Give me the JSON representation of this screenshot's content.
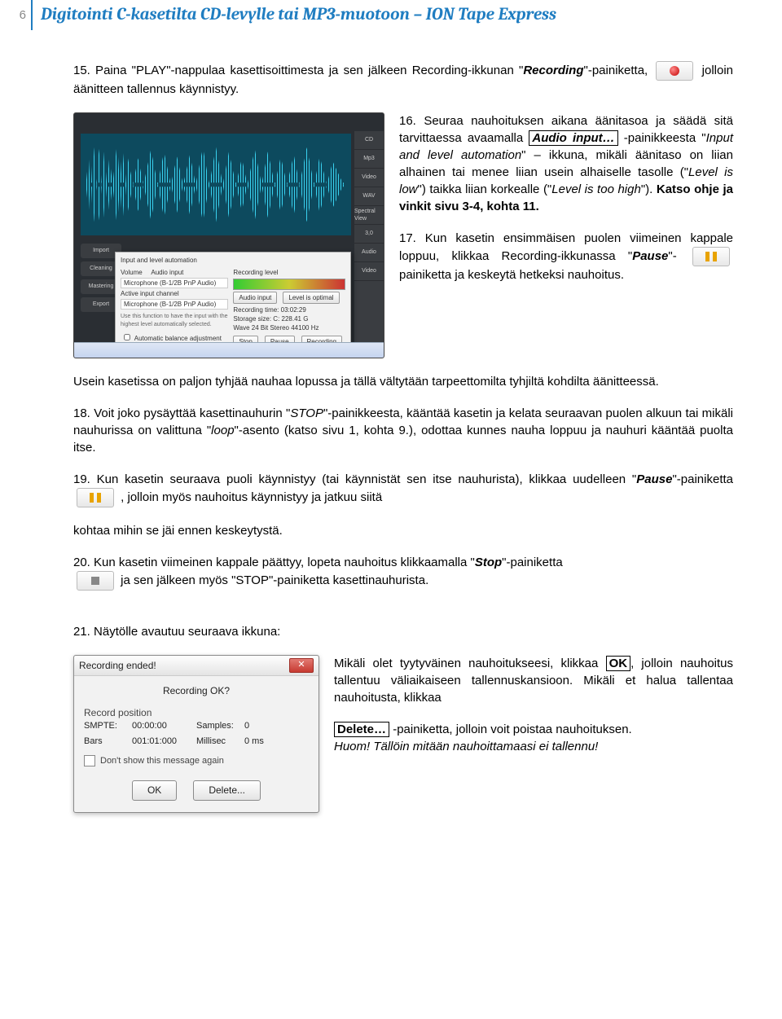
{
  "header": {
    "page_num": "6",
    "title": "Digitointi C-kasetilta CD-levylle tai MP3-muotoon – ION Tape Express"
  },
  "p15": {
    "prefix": "15. Paina \"PLAY\"-nappulaa kasettisoittimesta ja sen jälkeen Recording-ikkunan \"",
    "rec": "Recording",
    "mid": "\"-painiketta,",
    "suffix": "jolloin äänitteen tallennus käynnistyy."
  },
  "p16": {
    "a": "16. Seuraa nauhoituksen aikana äänitasoa ja säädä sitä tarvittaessa avaamalla ",
    "ai": "Audio input…",
    "b": " -painikkeesta \"",
    "it1": "Input and level automation",
    "c": "\" – ikkuna, mikäli äänitaso on liian alhainen tai menee liian usein alhaiselle tasolle (\"",
    "it2": "Level is low",
    "d": "\") taikka liian korkealle (\"",
    "it3": "Level is too high",
    "e": "\"). ",
    "bold": "Katso ohje ja vinkit sivu 3-4, kohta 11."
  },
  "p17": {
    "a": "17. Kun kasetin ensimmäisen puolen viimeinen kappale loppuu, klikkaa Recording-ikkunassa \"",
    "pause": "Pause",
    "b": "\"-",
    "c": "painiketta ja keskeytä hetkeksi nauhoitus."
  },
  "pUsein": "Usein kasetissa on paljon tyhjää nauhaa lopussa ja tällä vältytään tarpeettomilta tyhjiltä kohdilta äänitteessä.",
  "p18": {
    "a": "18. Voit joko pysäyttää kasettinauhurin \"",
    "stop": "STOP",
    "b": "\"-painikkeesta, kääntää kasetin ja kelata seuraavan puolen alkuun tai mikäli nauhurissa on valittuna \"",
    "loop": "loop",
    "c": "\"-asento (katso sivu 1, kohta 9.), odottaa kunnes nauha loppuu ja nauhuri kääntää puolta itse."
  },
  "p19": {
    "a": "19. Kun kasetin seuraava puoli käynnistyy (tai käynnistät sen itse nauhurista), klikkaa uudelleen \"",
    "pause": "Pause",
    "b": "\"-painiketta",
    "c": ", jolloin myös nauhoitus käynnistyy ja jatkuu siitä",
    "d": "kohtaa mihin se jäi ennen keskeytystä."
  },
  "p20": {
    "a": "20. Kun kasetin viimeinen kappale päättyy, lopeta nauhoitus klikkaamalla \"",
    "stop": "Stop",
    "b": "\"-painiketta",
    "c": "ja sen jälkeen myös \"STOP\"-painiketta kasettinauhurista."
  },
  "p21": {
    "lead": "21. Näytölle avautuu seuraava ikkuna:",
    "text1a": "Mikäli olet tyytyväinen nauhoitukseesi, klikkaa ",
    "ok": "OK",
    "text1b": ", jolloin nauhoitus tallentuu väliaikaiseen tallennuskansioon. Mikäli et halua tallentaa nauhoitusta, klikkaa",
    "del": "Delete…",
    "text2": " -painiketta, jolloin voit poistaa nauhoituksen.",
    "huom": "Huom! Tällöin mitään nauhoittamaasi ei tallennu!"
  },
  "dialog21": {
    "title": "Recording ended!",
    "message": "Recording OK?",
    "section": "Record position",
    "rows": {
      "r1c1": "SMPTE:",
      "r1c2": "00:00:00",
      "r1c3": "Samples:",
      "r1c4": "0",
      "r2c1": "Bars",
      "r2c2": "001:01:000",
      "r2c3": "Millisec",
      "r2c4": "0 ms"
    },
    "checkbox": "Don't show this message again",
    "ok": "OK",
    "del": "Delete..."
  },
  "screenshot": {
    "side": [
      "CD",
      "Mp3",
      "Video",
      "WAV",
      "Spectral View",
      "3,0",
      "Audio",
      "Video"
    ],
    "left": [
      "Import",
      "Cleaning",
      "Mastering",
      "Export"
    ]
  }
}
